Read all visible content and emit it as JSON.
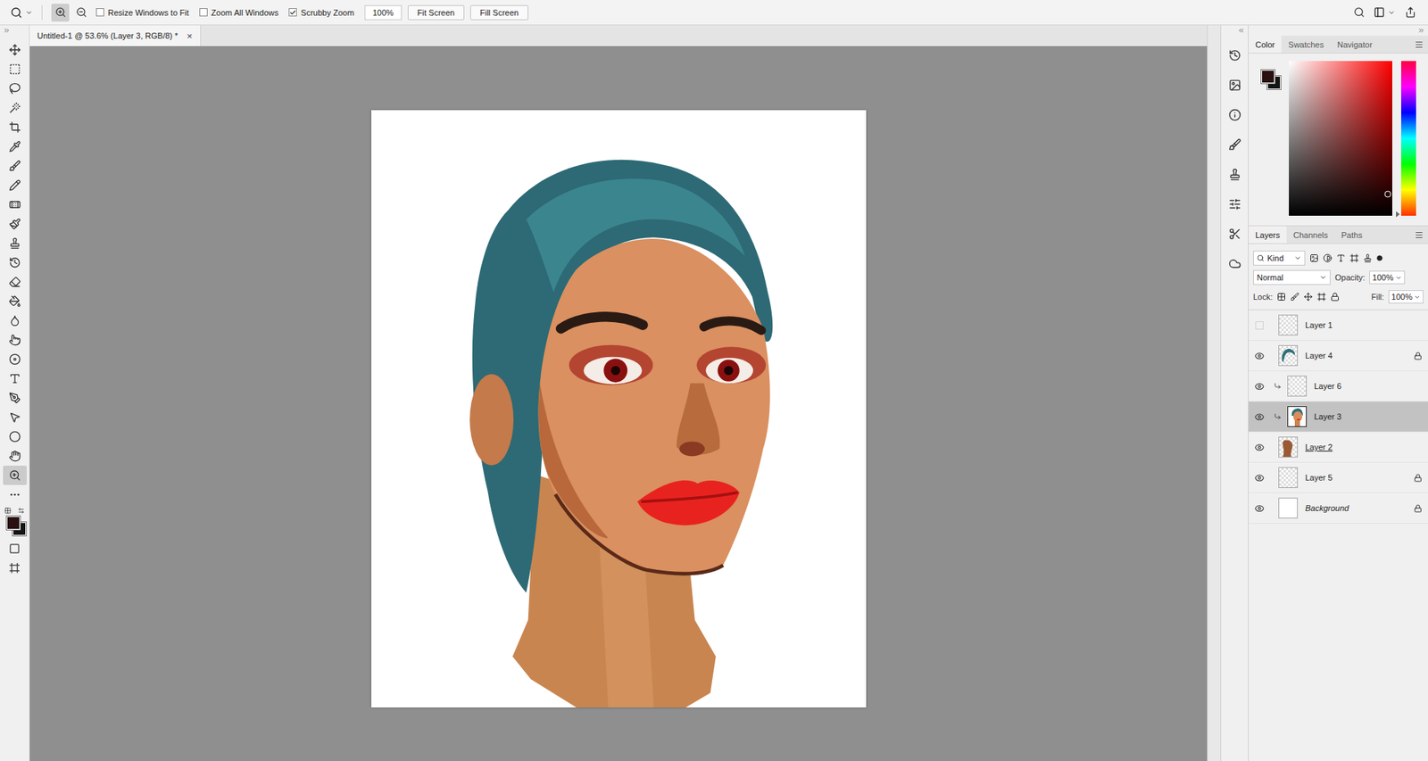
{
  "options_bar": {
    "zoom_modes": [
      {
        "kind": "zoom-in",
        "selected": true
      },
      {
        "kind": "zoom-out",
        "selected": false
      }
    ],
    "checkboxes": [
      {
        "label": "Resize Windows to Fit",
        "checked": false
      },
      {
        "label": "Zoom All Windows",
        "checked": false
      },
      {
        "label": "Scrubby Zoom",
        "checked": true
      }
    ],
    "zoom_field": "100%",
    "buttons": [
      "Fit Screen",
      "Fill Screen"
    ]
  },
  "document_tab": {
    "title": "Untitled-1 @ 53.6% (Layer 3, RGB/8) *",
    "close": "×"
  },
  "tools": [
    {
      "kind": "move",
      "selected": false
    },
    {
      "kind": "marquee",
      "selected": false
    },
    {
      "kind": "lasso",
      "selected": false
    },
    {
      "kind": "quick-select",
      "selected": false
    },
    {
      "kind": "crop",
      "selected": false
    },
    {
      "kind": "eyedropper",
      "selected": false
    },
    {
      "kind": "brush",
      "selected": false
    },
    {
      "kind": "pencil",
      "selected": false
    },
    {
      "kind": "spot-heal",
      "selected": false
    },
    {
      "kind": "mixer-brush",
      "selected": false
    },
    {
      "kind": "clone-stamp",
      "selected": false
    },
    {
      "kind": "history-brush",
      "selected": false
    },
    {
      "kind": "eraser",
      "selected": false
    },
    {
      "kind": "paint-bucket",
      "selected": false
    },
    {
      "kind": "blur",
      "selected": false
    },
    {
      "kind": "smudge",
      "selected": false
    },
    {
      "kind": "sponge",
      "selected": false
    },
    {
      "kind": "type",
      "selected": false
    },
    {
      "kind": "pen",
      "selected": false
    },
    {
      "kind": "path-select",
      "selected": false
    },
    {
      "kind": "ellipse",
      "selected": false
    },
    {
      "kind": "hand",
      "selected": false
    },
    {
      "kind": "zoom",
      "selected": true
    },
    {
      "kind": "more",
      "selected": false
    }
  ],
  "swatches": {
    "foreground": "#2a1010",
    "background": "#141414"
  },
  "bottom_tools": [
    {
      "kind": "quick-mask"
    },
    {
      "kind": "screen-mode"
    }
  ],
  "right_strip": [
    {
      "kind": "history"
    },
    {
      "kind": "properties"
    },
    {
      "kind": "info"
    },
    {
      "kind": "brush-settings"
    },
    {
      "kind": "clone-source"
    },
    {
      "kind": "adjustments"
    },
    {
      "kind": "tool-presets"
    },
    {
      "kind": "libraries"
    }
  ],
  "color_panel": {
    "tabs": [
      {
        "label": "Color",
        "selected": true
      },
      {
        "label": "Swatches",
        "selected": false
      },
      {
        "label": "Navigator",
        "selected": false
      }
    ],
    "hue": "#ff0000",
    "saturation": 0.96,
    "brightness": 0.14,
    "hue_level": 0.99
  },
  "layers_panel": {
    "tabs": [
      {
        "label": "Layers",
        "selected": true
      },
      {
        "label": "Channels",
        "selected": false
      },
      {
        "label": "Paths",
        "selected": false
      }
    ],
    "filter": "Kind",
    "blend_mode": "Normal",
    "opacity_label": "Opacity:",
    "opacity": "100%",
    "lock_label": "Lock:",
    "fill_label": "Fill:",
    "fill": "100%",
    "layers": [
      {
        "name": "Layer 1",
        "kind": "empty",
        "visible": false,
        "locked": false,
        "clipped": false,
        "selected": false,
        "italic": false,
        "underlined": false
      },
      {
        "name": "Layer 4",
        "kind": "hair",
        "visible": true,
        "locked": true,
        "clipped": false,
        "selected": false,
        "italic": false,
        "underlined": false
      },
      {
        "name": "Layer 6",
        "kind": "empty",
        "visible": true,
        "locked": false,
        "clipped": true,
        "selected": false,
        "italic": false,
        "underlined": false
      },
      {
        "name": "Layer 3",
        "kind": "portrait",
        "visible": true,
        "locked": false,
        "clipped": true,
        "selected": true,
        "italic": false,
        "underlined": false
      },
      {
        "name": "Layer 2",
        "kind": "skin",
        "visible": true,
        "locked": false,
        "clipped": false,
        "selected": false,
        "italic": false,
        "underlined": true
      },
      {
        "name": "Layer 5",
        "kind": "empty",
        "visible": true,
        "locked": true,
        "clipped": false,
        "selected": false,
        "italic": false,
        "underlined": false
      },
      {
        "name": "Background",
        "kind": "white",
        "visible": true,
        "locked": true,
        "clipped": false,
        "selected": false,
        "italic": true,
        "underlined": false
      }
    ]
  }
}
